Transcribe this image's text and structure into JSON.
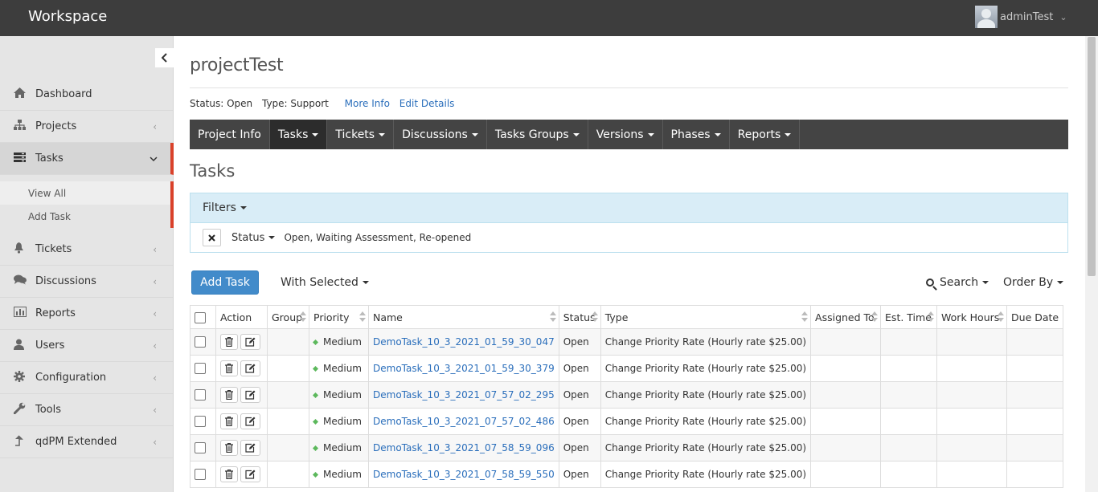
{
  "app": {
    "title": "Workspace",
    "user": "adminTest"
  },
  "sidebar": {
    "items": [
      {
        "label": "Dashboard",
        "icon": "home-icon"
      },
      {
        "label": "Projects",
        "icon": "sitemap-icon"
      },
      {
        "label": "Tasks",
        "icon": "tasks-icon",
        "active": true
      },
      {
        "label": "Tickets",
        "icon": "bell-icon"
      },
      {
        "label": "Discussions",
        "icon": "comments-icon"
      },
      {
        "label": "Reports",
        "icon": "bar-chart-icon"
      },
      {
        "label": "Users",
        "icon": "user-icon"
      },
      {
        "label": "Configuration",
        "icon": "gear-icon"
      },
      {
        "label": "Tools",
        "icon": "wrench-icon"
      },
      {
        "label": "qdPM Extended",
        "icon": "level-up-icon"
      }
    ],
    "subitems": [
      {
        "label": "View All"
      },
      {
        "label": "Add Task"
      }
    ]
  },
  "project": {
    "name": "projectTest",
    "status": "Status: Open",
    "type": "Type: Support",
    "more_info": "More Info",
    "edit_details": "Edit Details"
  },
  "tabs": [
    "Project Info",
    "Tasks",
    "Tickets",
    "Discussions",
    "Tasks Groups",
    "Versions",
    "Phases",
    "Reports"
  ],
  "section_title": "Tasks",
  "filters": {
    "title": "Filters",
    "field": "Status",
    "value": "Open, Waiting Assessment, Re-opened"
  },
  "toolbar": {
    "add_task": "Add Task",
    "with_selected": "With Selected",
    "search": "Search",
    "order_by": "Order By"
  },
  "table": {
    "headers": [
      "Action",
      "Group",
      "Priority",
      "Name",
      "Status",
      "Type",
      "Assigned To",
      "Est. Time",
      "Work Hours",
      "Due Date"
    ],
    "rows": [
      {
        "priority": "Medium",
        "name": "DemoTask_10_3_2021_01_59_30_047",
        "status": "Open",
        "type": "Change Priority Rate (Hourly rate $25.00)"
      },
      {
        "priority": "Medium",
        "name": "DemoTask_10_3_2021_01_59_30_379",
        "status": "Open",
        "type": "Change Priority Rate (Hourly rate $25.00)"
      },
      {
        "priority": "Medium",
        "name": "DemoTask_10_3_2021_07_57_02_295",
        "status": "Open",
        "type": "Change Priority Rate (Hourly rate $25.00)"
      },
      {
        "priority": "Medium",
        "name": "DemoTask_10_3_2021_07_57_02_486",
        "status": "Open",
        "type": "Change Priority Rate (Hourly rate $25.00)"
      },
      {
        "priority": "Medium",
        "name": "DemoTask_10_3_2021_07_58_59_096",
        "status": "Open",
        "type": "Change Priority Rate (Hourly rate $25.00)"
      },
      {
        "priority": "Medium",
        "name": "DemoTask_10_3_2021_07_58_59_550",
        "status": "Open",
        "type": "Change Priority Rate (Hourly rate $25.00)"
      }
    ]
  },
  "colors": {
    "topbar": "#3d3d3d",
    "accent": "#d9412a",
    "primary": "#428bca",
    "link": "#2a6ebb"
  }
}
